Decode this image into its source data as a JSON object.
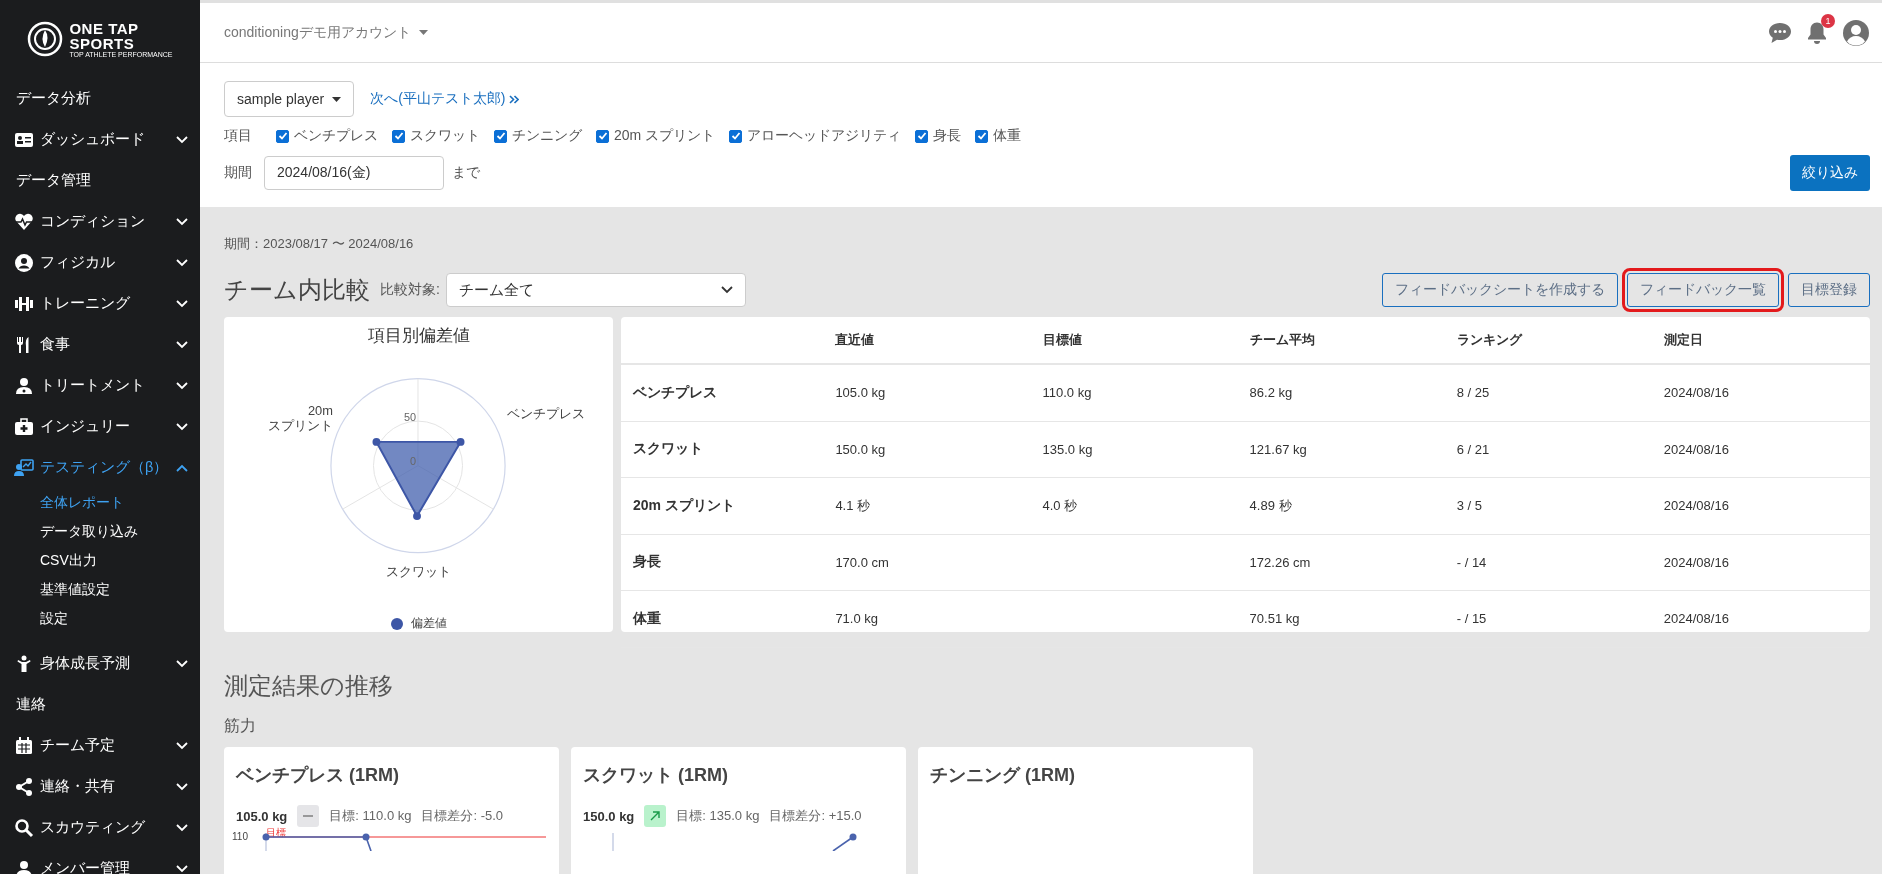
{
  "sidebar": {
    "logo": {
      "line1": "ONE TAP",
      "line2": "SPORTS",
      "tagline": "TOP ATHLETE PERFORMANCE"
    },
    "items": [
      {
        "kind": "header",
        "label": "データ分析"
      },
      {
        "kind": "menu",
        "label": "ダッシュボード",
        "expanded": false
      },
      {
        "kind": "header",
        "label": "データ管理"
      },
      {
        "kind": "menu",
        "label": "コンディション",
        "expanded": false
      },
      {
        "kind": "menu",
        "label": "フィジカル",
        "expanded": false
      },
      {
        "kind": "menu",
        "label": "トレーニング",
        "expanded": false
      },
      {
        "kind": "menu",
        "label": "食事",
        "expanded": false
      },
      {
        "kind": "menu",
        "label": "トリートメント",
        "expanded": false
      },
      {
        "kind": "menu",
        "label": "インジュリー",
        "expanded": false
      },
      {
        "kind": "menu",
        "label": "テスティング（β）",
        "expanded": true,
        "children": [
          {
            "label": "全体レポート",
            "selected": true
          },
          {
            "label": "データ取り込み",
            "selected": false
          },
          {
            "label": "CSV出力",
            "selected": false
          },
          {
            "label": "基準値設定",
            "selected": false
          },
          {
            "label": "設定",
            "selected": false
          }
        ]
      },
      {
        "kind": "menu",
        "label": "身体成長予測",
        "expanded": false
      },
      {
        "kind": "header",
        "label": "連絡"
      },
      {
        "kind": "menu",
        "label": "チーム予定",
        "expanded": false
      },
      {
        "kind": "menu",
        "label": "連絡・共有",
        "expanded": false
      },
      {
        "kind": "menu",
        "label": "スカウティング",
        "expanded": false
      },
      {
        "kind": "menu",
        "label": "メンバー管理",
        "expanded": false
      }
    ]
  },
  "topbar": {
    "account": "conditioningデモ用アカウント",
    "notification_count": "1"
  },
  "filters": {
    "player": "sample player",
    "next_link": "次へ(平山テスト太郎)",
    "items_label": "項目",
    "items": [
      {
        "label": "ベンチプレス",
        "checked": true
      },
      {
        "label": "スクワット",
        "checked": true
      },
      {
        "label": "チンニング",
        "checked": true
      },
      {
        "label": "20m スプリント",
        "checked": true
      },
      {
        "label": "アローヘッドアジリティ",
        "checked": true
      },
      {
        "label": "身長",
        "checked": true
      },
      {
        "label": "体重",
        "checked": true
      }
    ],
    "period_label": "期間",
    "date": "2024/08/16(金)",
    "until": "まで",
    "apply_button": "絞り込み"
  },
  "comparison": {
    "period": "期間：2023/08/17 〜 2024/08/16",
    "title": "チーム内比較",
    "target_label": "比較対象:",
    "target": "チーム全て",
    "buttons": [
      {
        "label": "フィードバックシートを作成する",
        "highlighted": false
      },
      {
        "label": "フィードバック一覧",
        "highlighted": true
      },
      {
        "label": "目標登録",
        "highlighted": false
      }
    ],
    "radar": {
      "title": "項目別偏差値",
      "tick_labels": [
        "50",
        "0"
      ],
      "axis_labels": [
        "ベンチプレス",
        "スクワット",
        "20m\nスプリント"
      ],
      "legend": "偏差値"
    },
    "table": {
      "columns": [
        "直近値",
        "目標値",
        "チーム平均",
        "ランキング",
        "測定日"
      ],
      "rows": [
        {
          "label": "ベンチプレス",
          "cells": [
            "105.0 kg",
            "110.0 kg",
            "86.2 kg",
            "8 / 25",
            "2024/08/16"
          ]
        },
        {
          "label": "スクワット",
          "cells": [
            "150.0 kg",
            "135.0 kg",
            "121.67 kg",
            "6 / 21",
            "2024/08/16"
          ]
        },
        {
          "label": "20m スプリント",
          "cells": [
            "4.1 秒",
            "4.0 秒",
            "4.89 秒",
            "3 / 5",
            "2024/08/16"
          ]
        },
        {
          "label": "身長",
          "cells": [
            "170.0 cm",
            null,
            "172.26 cm",
            "- / 14",
            "2024/08/16"
          ]
        },
        {
          "label": "体重",
          "cells": [
            "71.0 kg",
            null,
            "70.51 kg",
            "- / 15",
            "2024/08/16"
          ]
        }
      ]
    }
  },
  "trends": {
    "title": "測定結果の推移",
    "group": "筋力",
    "cards": [
      {
        "title": "ベンチプレス (1RM)",
        "value": "105.0 kg",
        "kind": "flat",
        "target": "目標: 110.0 kg",
        "diff": "目標差分: -5.0",
        "y_tick": "110",
        "target_line_label": "目標"
      },
      {
        "title": "スクワット (1RM)",
        "value": "150.0 kg",
        "kind": "up",
        "target": "目標: 135.0 kg",
        "diff": "目標差分: +15.0"
      },
      {
        "title": "チンニング (1RM)",
        "kind": "plain"
      }
    ]
  }
}
